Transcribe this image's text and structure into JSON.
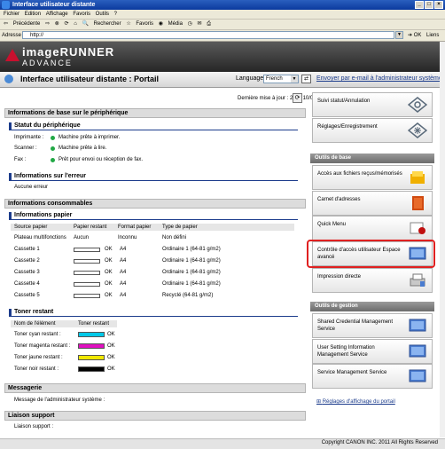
{
  "window": {
    "title": "Interface utilisateur distante"
  },
  "menu": [
    "Fichier",
    "Edition",
    "Affichage",
    "Favoris",
    "Outils",
    "?"
  ],
  "toolbar": [
    "Précédente",
    "Rechercher",
    "Favoris",
    "Média"
  ],
  "address": {
    "label": "Adresse",
    "url": "http://",
    "go": "OK",
    "links": "Liens"
  },
  "brand": {
    "main": "imageRUNNER",
    "sub": "ADVANCE"
  },
  "portal": {
    "title": "Interface utilisateur distante : Portail",
    "language_label": "Language",
    "language_value": "French",
    "email_link": "Envoyer par e-mail à l'administrateur système"
  },
  "last_update": "Dernière mise à jour : 2011 10/05 18:58:55",
  "device_info": {
    "section": "Informations de base sur le périphérique",
    "status_header": "Statut du périphérique",
    "rows": [
      {
        "label": "Imprimante :",
        "value": "Machine prête à imprimer."
      },
      {
        "label": "Scanner :",
        "value": "Machine prête à lire."
      },
      {
        "label": "Fax :",
        "value": "Prêt pour envoi ou réception de fax."
      }
    ]
  },
  "errors": {
    "header": "Informations sur l'erreur",
    "value": "Aucune erreur"
  },
  "consumables": {
    "section": "Informations consommables",
    "paper_header": "Informations papier",
    "columns": [
      "Source papier",
      "Papier restant",
      "Format papier",
      "Type de papier"
    ],
    "rows": [
      {
        "source": "Plateau multifonctions",
        "remaining": "Aucun",
        "size": "Inconnu",
        "type": "Non défini",
        "level": null
      },
      {
        "source": "Cassette 1",
        "remaining": "OK",
        "size": "A4",
        "type": "Ordinaire 1 (64-81 g/m2)",
        "level": 0
      },
      {
        "source": "Cassette 2",
        "remaining": "OK",
        "size": "A4",
        "type": "Ordinaire 1 (64-81 g/m2)",
        "level": 0
      },
      {
        "source": "Cassette 3",
        "remaining": "OK",
        "size": "A4",
        "type": "Ordinaire 1 (64-81 g/m2)",
        "level": 0
      },
      {
        "source": "Cassette 4",
        "remaining": "OK",
        "size": "A4",
        "type": "Ordinaire 1 (64-81 g/m2)",
        "level": 0
      },
      {
        "source": "Cassette 5",
        "remaining": "OK",
        "size": "A4",
        "type": "Recyclé (64-81 g/m2)",
        "level": 0
      }
    ],
    "toner_header": "Toner restant",
    "toner_columns": [
      "Nom de l'élément",
      "Toner restant"
    ],
    "toners": [
      {
        "name": "Toner cyan restant :",
        "status": "OK",
        "color": "#00c8e8"
      },
      {
        "name": "Toner magenta restant :",
        "status": "OK",
        "color": "#e010c0"
      },
      {
        "name": "Toner jaune restant :",
        "status": "OK",
        "color": "#f0e800"
      },
      {
        "name": "Toner noir restant :",
        "status": "OK",
        "color": "#000000"
      }
    ]
  },
  "messages": {
    "section": "Messagerie",
    "label": "Message de l'administrateur système :"
  },
  "support": {
    "section": "Liaison support",
    "label": "Liaison support :"
  },
  "sidebar": {
    "top_buttons": [
      "Suivi statut/Annulation",
      "Réglages/Enregistrement"
    ],
    "basic_header": "Outils de base",
    "basic_buttons": [
      "Accès aux fichiers reçus/mémorisés",
      "Carnet d'adresses",
      "Quick Menu",
      "Contrôle d'accès utilisateur Espace avancé",
      "Impression directe"
    ],
    "mgmt_header": "Outils de gestion",
    "mgmt_buttons": [
      "Shared Credential Management Service",
      "User Setting Information Management Service",
      "Service Management Service"
    ],
    "portal_settings": "Réglages d'affichage du portail"
  },
  "footer": {
    "copyright": "Copyright CANON INC. 2011 All Rights Reserved"
  }
}
